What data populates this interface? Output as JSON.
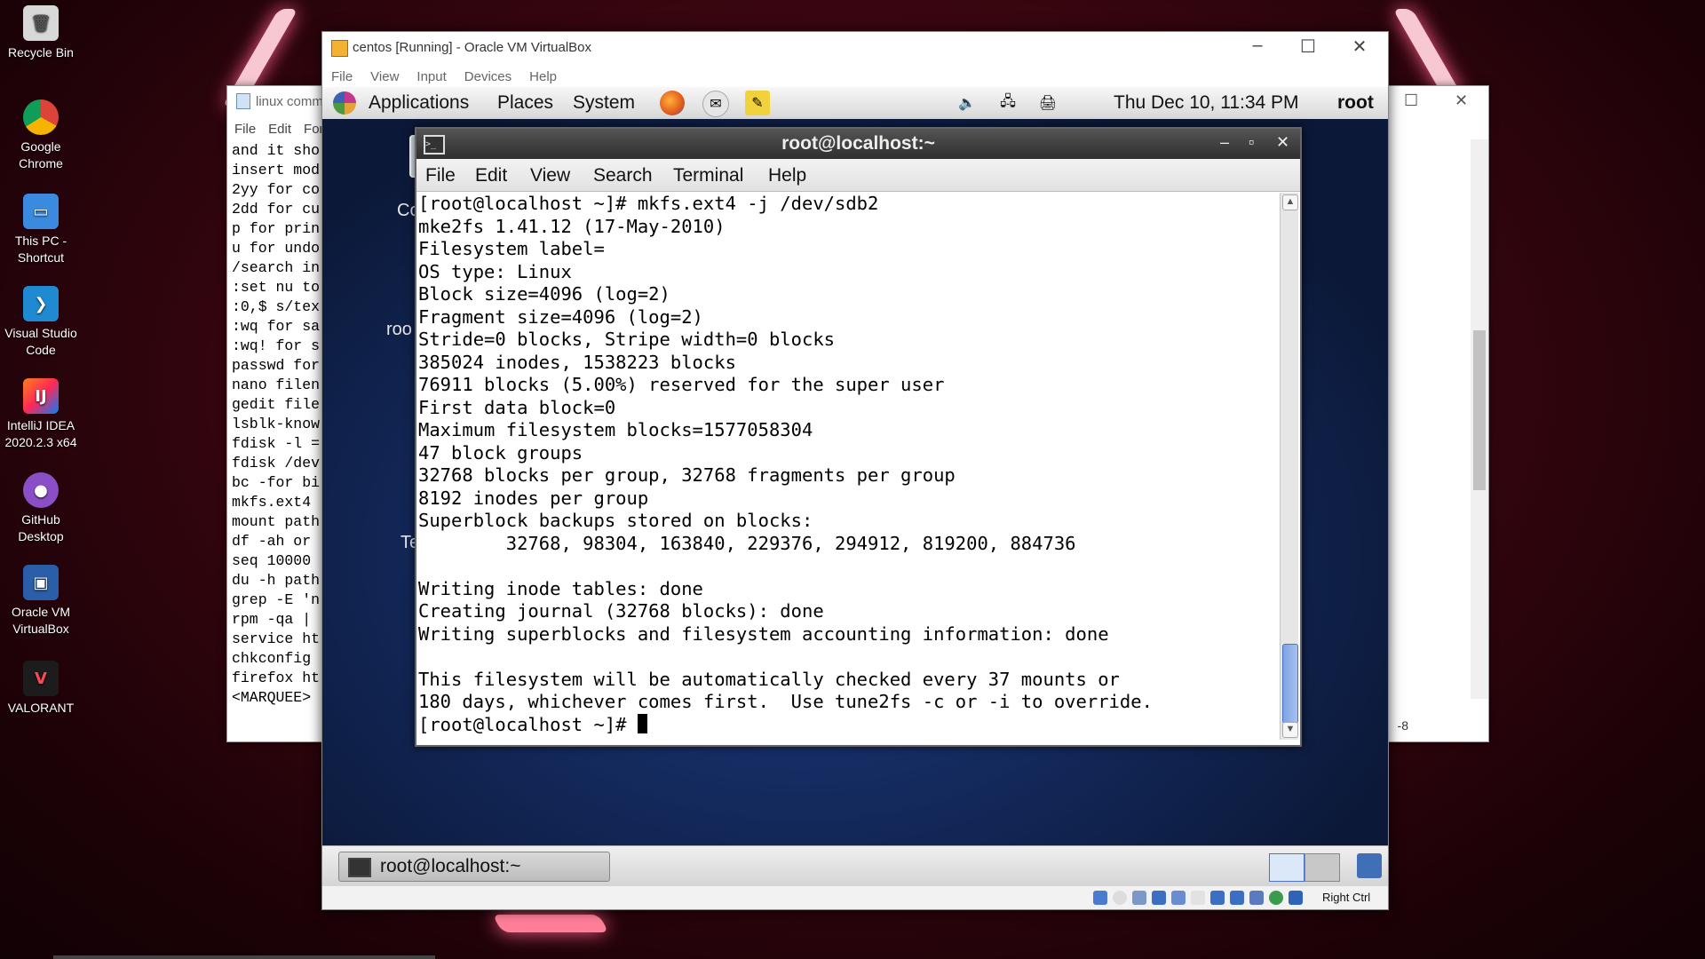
{
  "desktop": {
    "icons": [
      {
        "label": "Recycle Bin",
        "icon": "recycle-bin-icon"
      },
      {
        "label": "Google Chrome",
        "icon": "chrome-icon"
      },
      {
        "label": "This PC - Shortcut",
        "icon": "this-pc-icon"
      },
      {
        "label": "Visual Studio Code",
        "icon": "vscode-icon"
      },
      {
        "label": "IntelliJ IDEA 2020.2.3 x64",
        "icon": "intellij-icon"
      },
      {
        "label": "GitHub Desktop",
        "icon": "github-desktop-icon"
      },
      {
        "label": "Oracle VM VirtualBox",
        "icon": "virtualbox-icon"
      },
      {
        "label": "VALORANT",
        "icon": "valorant-icon"
      }
    ]
  },
  "notepad": {
    "title": "linux comm",
    "menu": [
      "File",
      "Edit",
      "For"
    ],
    "lines": [
      "and it sho",
      "insert mode",
      "2yy for co",
      "2dd for cu",
      "p for prin",
      "u for undo",
      "/search in",
      ":set nu to",
      ":0,$ s/tex",
      ":wq for sa",
      ":wq! for s",
      "passwd for",
      "nano filen",
      "gedit file",
      "lsblk-know",
      "fdisk -l =",
      "fdisk /dev",
      "bc -for bi",
      "mkfs.ext4 ",
      "mount path",
      "df -ah or ",
      "seq 10000 ",
      "du -h path",
      "grep -E 'n",
      "rpm -qa | ",
      "service ht",
      "chkconfig ",
      "firefox ht",
      "<MARQUEE>"
    ],
    "status": "-8"
  },
  "vbox": {
    "title": "centos [Running] - Oracle VM VirtualBox",
    "menu": [
      "File",
      "View",
      "Input",
      "Devices",
      "Help"
    ],
    "status_right": "Right Ctrl"
  },
  "guest": {
    "panel": {
      "menu": [
        "Applications",
        "Places",
        "System"
      ],
      "clock": "Thu Dec 10, 11:34 PM",
      "user": "root"
    },
    "desktop_labels": [
      "Co",
      "roo",
      "Te"
    ],
    "terminal": {
      "title": "root@localhost:~",
      "menu": [
        "File",
        "Edit",
        "View",
        "Search",
        "Terminal",
        "Help"
      ],
      "output": "[root@localhost ~]# mkfs.ext4 -j /dev/sdb2\nmke2fs 1.41.12 (17-May-2010)\nFilesystem label=\nOS type: Linux\nBlock size=4096 (log=2)\nFragment size=4096 (log=2)\nStride=0 blocks, Stripe width=0 blocks\n385024 inodes, 1538223 blocks\n76911 blocks (5.00%) reserved for the super user\nFirst data block=0\nMaximum filesystem blocks=1577058304\n47 block groups\n32768 blocks per group, 32768 fragments per group\n8192 inodes per group\nSuperblock backups stored on blocks:\n        32768, 98304, 163840, 229376, 294912, 819200, 884736\n\nWriting inode tables: done\nCreating journal (32768 blocks): done\nWriting superblocks and filesystem accounting information: done\n\nThis filesystem will be automatically checked every 37 mounts or\n180 days, whichever comes first.  Use tune2fs -c or -i to override.\n",
      "prompt": "[root@localhost ~]# "
    },
    "taskbar": {
      "task_label": "root@localhost:~"
    }
  },
  "colors": {
    "accent": "#4b73c1",
    "desktop_bg": "#3a0610",
    "guest_bg": "#142a5e"
  }
}
